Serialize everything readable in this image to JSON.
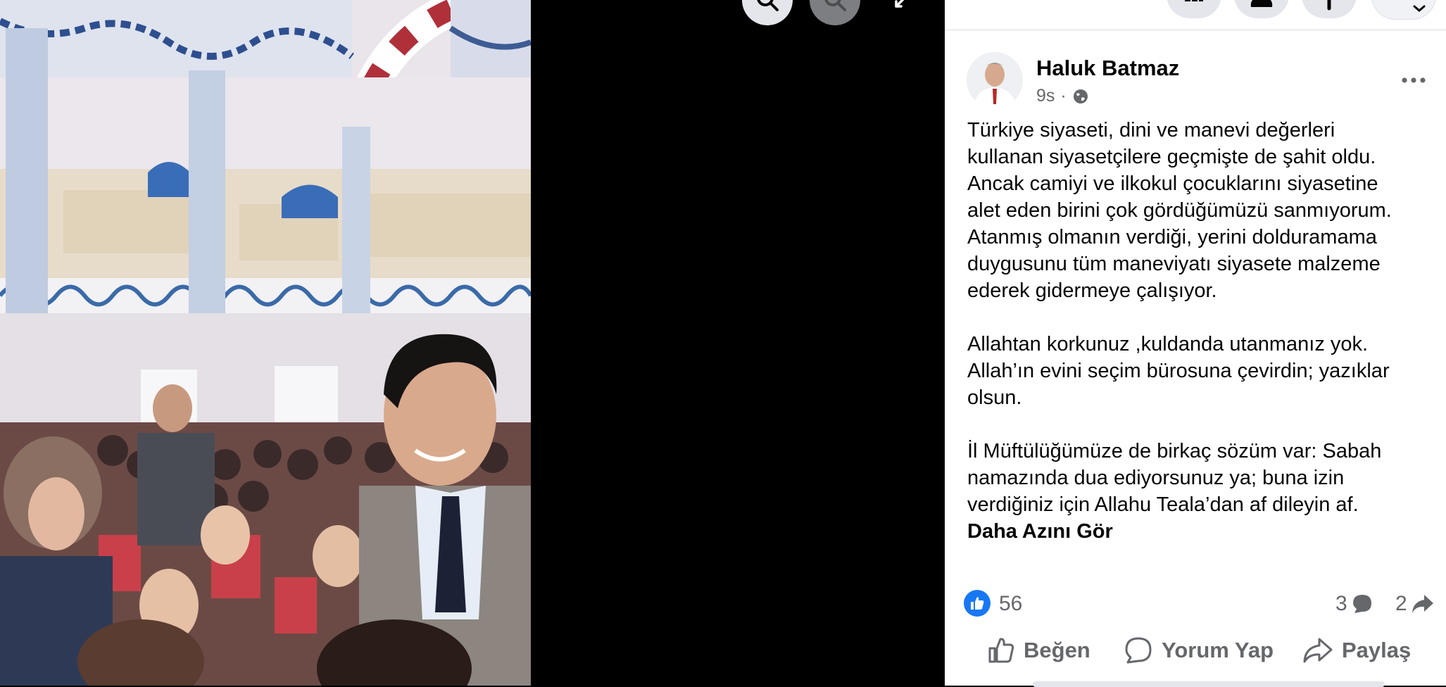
{
  "post": {
    "author": "Haluk Batmaz",
    "time": "9s",
    "separator": "·",
    "audience_icon": "globe-icon",
    "paragraphs": [
      "Türkiye siyaseti, dini ve manevi değerleri\nkullanan siyasetçilere geçmişte de şahit oldu.\nAncak camiyi ve ilkokul çocuklarını siyasetine\nalet eden birini çok gördüğümüzü sanmıyorum.\nAtanmış olmanın verdiği, yerini dolduramama\nduygusunu tüm maneviyatı siyasete malzeme\nederek gidermeye çalışıyor.",
      "Allahtan korkunuz ,kuldanda utanmanız yok.\nAllah’ın evini seçim bürosuna çevirdin; yazıklar\nolsun.",
      "İl Müftülüğümüze de birkaç sözüm var: Sabah\nnamazında dua ediyorsunuz ya; buna izin\nverdiğiniz için Allahu Teala’dan af dileyin af."
    ],
    "see_more": "Daha Azını Gör"
  },
  "stats": {
    "likes": "56",
    "comments": "3",
    "shares": "2"
  },
  "actions": {
    "like": "Beğen",
    "comment": "Yorum Yap",
    "share": "Paylaş"
  },
  "colors": {
    "brand_blue": "#1877f2",
    "secondary_text": "#65676b",
    "primary_text": "#050505",
    "button_bg": "#e4e6eb"
  }
}
